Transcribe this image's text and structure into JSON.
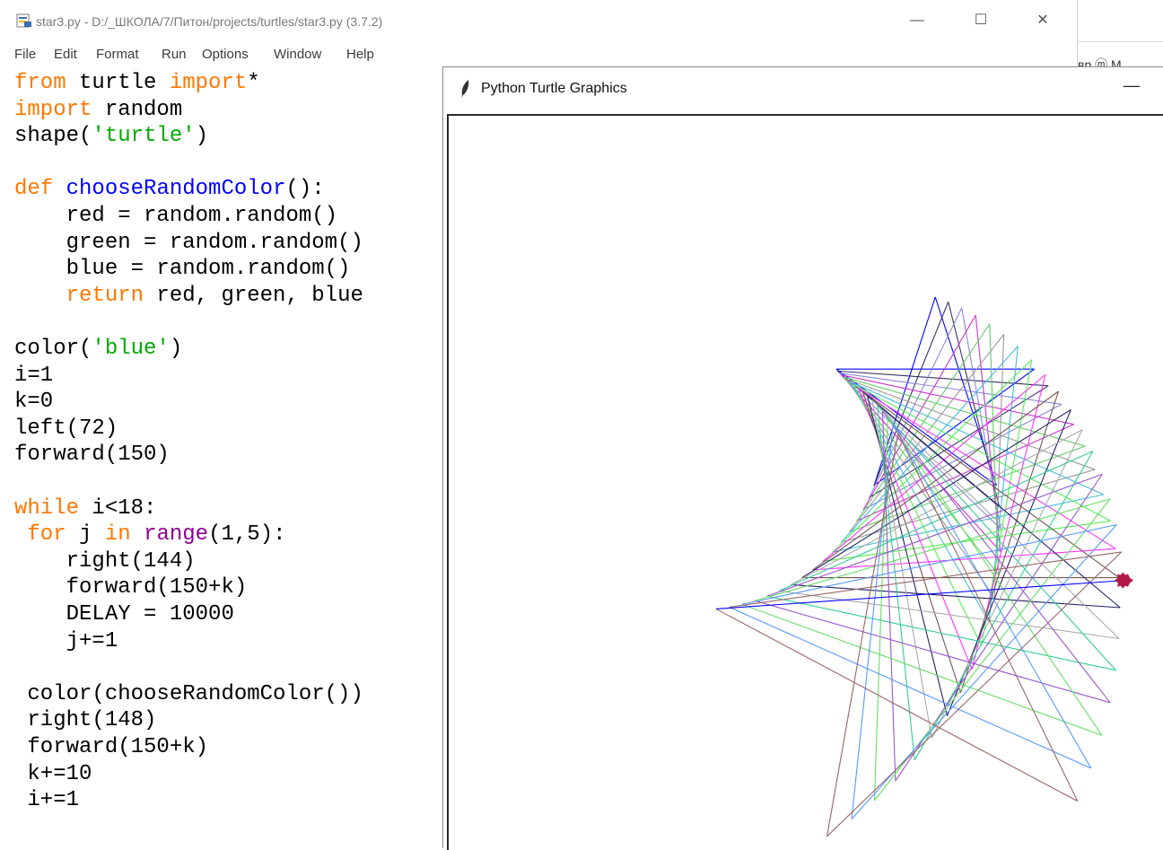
{
  "idle": {
    "title": "star3.py - D:/_ШКОЛА/7/Питон/projects/turtles/star3.py (3.7.2)",
    "controls": {
      "minimize": "—",
      "maximize": "☐",
      "close": "✕"
    },
    "menu": [
      "File",
      "Edit",
      "Format",
      "Run",
      "Options",
      "Window",
      "Help"
    ],
    "code": [
      [
        [
          "kw",
          "from"
        ],
        [
          "t",
          " turtle "
        ],
        [
          "kw",
          "import"
        ],
        [
          "t",
          "*"
        ]
      ],
      [
        [
          "kw",
          "import"
        ],
        [
          "t",
          " random"
        ]
      ],
      [
        [
          "t",
          "shape("
        ],
        [
          "str",
          "'turtle'"
        ],
        [
          "t",
          ")"
        ]
      ],
      [],
      [
        [
          "kw",
          "def"
        ],
        [
          "t",
          " "
        ],
        [
          "fn",
          "chooseRandomColor"
        ],
        [
          "t",
          "():"
        ]
      ],
      [
        [
          "t",
          "    red = random.random()"
        ]
      ],
      [
        [
          "t",
          "    green = random.random()"
        ]
      ],
      [
        [
          "t",
          "    blue = random.random()"
        ]
      ],
      [
        [
          "t",
          "    "
        ],
        [
          "kw",
          "return"
        ],
        [
          "t",
          " red, green, blue"
        ]
      ],
      [],
      [
        [
          "t",
          "color("
        ],
        [
          "str",
          "'blue'"
        ],
        [
          "t",
          ")"
        ]
      ],
      [
        [
          "t",
          "i=1"
        ]
      ],
      [
        [
          "t",
          "k=0"
        ]
      ],
      [
        [
          "t",
          "left(72)"
        ]
      ],
      [
        [
          "t",
          "forward(150)"
        ]
      ],
      [],
      [
        [
          "kw",
          "while"
        ],
        [
          "t",
          " i<18:"
        ]
      ],
      [
        [
          "t",
          " "
        ],
        [
          "kw",
          "for"
        ],
        [
          "t",
          " j "
        ],
        [
          "kw",
          "in"
        ],
        [
          "t",
          " "
        ],
        [
          "bi",
          "range"
        ],
        [
          "t",
          "(1,5):"
        ]
      ],
      [
        [
          "t",
          "    right(144)"
        ]
      ],
      [
        [
          "t",
          "    forward(150+k)"
        ]
      ],
      [
        [
          "t",
          "    DELAY = 10000"
        ]
      ],
      [
        [
          "t",
          "    j+=1"
        ]
      ],
      [],
      [
        [
          "t",
          " color(chooseRandomColor())"
        ]
      ],
      [
        [
          "t",
          " right(148)"
        ]
      ],
      [
        [
          "t",
          " forward(150+k)"
        ]
      ],
      [
        [
          "t",
          " k+=10"
        ]
      ],
      [
        [
          "t",
          " i+=1"
        ]
      ]
    ]
  },
  "background_window": {
    "text": "вр  ⓜ M"
  },
  "turtle": {
    "title": "Python Turtle Graphics",
    "minimize": "—",
    "turtle_color": "#b0184a",
    "colors": [
      "#0000ff",
      "#333366",
      "#8888dd",
      "#cc33cc",
      "#66cc66",
      "#999999",
      "#44bbdd",
      "#55ee55",
      "#ff33ff",
      "#775555",
      "#222266",
      "#aaaaaa",
      "#33cc99",
      "#9955cc",
      "#66dd66",
      "#5599ff",
      "#996666"
    ]
  }
}
